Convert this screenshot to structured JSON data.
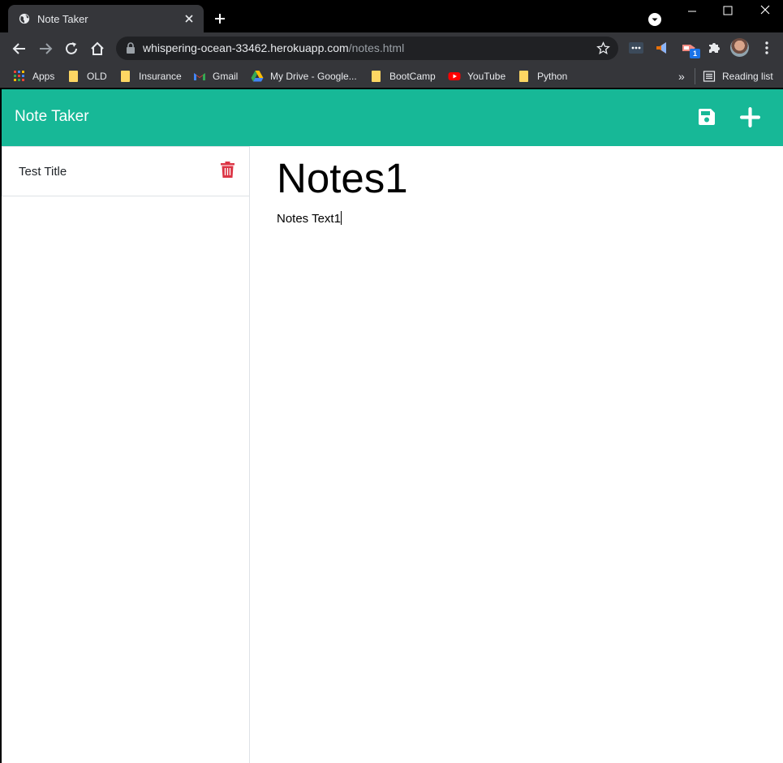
{
  "browser": {
    "tab_title": "Note Taker",
    "url_host": "whispering-ocean-33462.herokuapp.com",
    "url_path": "/notes.html",
    "extension_badge": "1",
    "bookmarks": [
      {
        "label": "Apps",
        "icon": "apps-grid-icon"
      },
      {
        "label": "OLD",
        "icon": "folder-icon"
      },
      {
        "label": "Insurance",
        "icon": "folder-icon"
      },
      {
        "label": "Gmail",
        "icon": "gmail-icon"
      },
      {
        "label": "My Drive - Google...",
        "icon": "google-drive-icon"
      },
      {
        "label": "BootCamp",
        "icon": "folder-icon"
      },
      {
        "label": "YouTube",
        "icon": "youtube-icon"
      },
      {
        "label": "Python",
        "icon": "folder-icon"
      }
    ],
    "overflow": "»",
    "reading_list": "Reading list"
  },
  "app": {
    "brand": "Note Taker",
    "accent_color": "#17b897",
    "delete_color": "#dc3545"
  },
  "notes_list": [
    {
      "title": "Test Title"
    }
  ],
  "active_note": {
    "title": "Notes1",
    "text": "Notes Text1"
  }
}
